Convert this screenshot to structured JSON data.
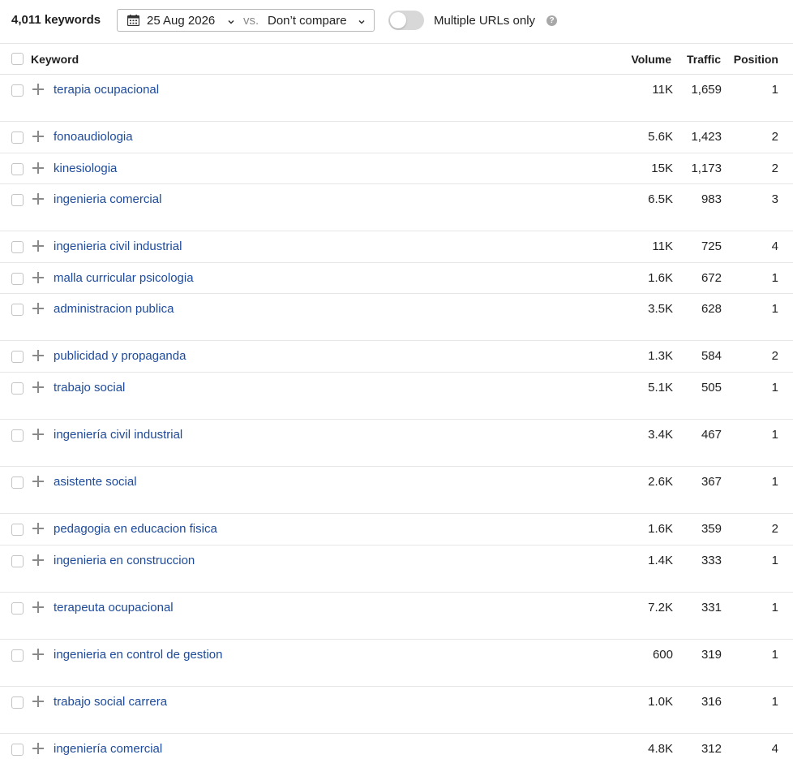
{
  "toolbar": {
    "keyword_count": "4,011 keywords",
    "date": "25 Aug 2026",
    "vs": "vs.",
    "compare": "Don’t compare",
    "multiple_urls_label": "Multiple URLs only",
    "multiple_urls_enabled": false,
    "help": "?"
  },
  "table": {
    "columns": {
      "keyword": "Keyword",
      "volume": "Volume",
      "traffic": "Traffic",
      "position": "Position"
    },
    "rows": [
      {
        "keyword": "terapia ocupacional",
        "volume": "11K",
        "traffic": "1,659",
        "position": "1"
      },
      {
        "keyword": "fonoaudiologia",
        "volume": "5.6K",
        "traffic": "1,423",
        "position": "2"
      },
      {
        "keyword": "kinesiologia",
        "volume": "15K",
        "traffic": "1,173",
        "position": "2"
      },
      {
        "keyword": "ingenieria comercial",
        "volume": "6.5K",
        "traffic": "983",
        "position": "3"
      },
      {
        "keyword": "ingenieria civil industrial",
        "volume": "11K",
        "traffic": "725",
        "position": "4"
      },
      {
        "keyword": "malla curricular psicologia",
        "volume": "1.6K",
        "traffic": "672",
        "position": "1"
      },
      {
        "keyword": "administracion publica",
        "volume": "3.5K",
        "traffic": "628",
        "position": "1"
      },
      {
        "keyword": "publicidad y propaganda",
        "volume": "1.3K",
        "traffic": "584",
        "position": "2"
      },
      {
        "keyword": "trabajo social",
        "volume": "5.1K",
        "traffic": "505",
        "position": "1"
      },
      {
        "keyword": "ingeniería civil industrial",
        "volume": "3.4K",
        "traffic": "467",
        "position": "1"
      },
      {
        "keyword": "asistente social",
        "volume": "2.6K",
        "traffic": "367",
        "position": "1"
      },
      {
        "keyword": "pedagogia en educacion fisica",
        "volume": "1.6K",
        "traffic": "359",
        "position": "2"
      },
      {
        "keyword": "ingenieria en construccion",
        "volume": "1.4K",
        "traffic": "333",
        "position": "1"
      },
      {
        "keyword": "terapeuta ocupacional",
        "volume": "7.2K",
        "traffic": "331",
        "position": "1"
      },
      {
        "keyword": "ingenieria en control de gestion",
        "volume": "600",
        "traffic": "319",
        "position": "1"
      },
      {
        "keyword": "trabajo social carrera",
        "volume": "1.0K",
        "traffic": "316",
        "position": "1"
      },
      {
        "keyword": "ingeniería comercial",
        "volume": "4.8K",
        "traffic": "312",
        "position": "4"
      }
    ]
  }
}
